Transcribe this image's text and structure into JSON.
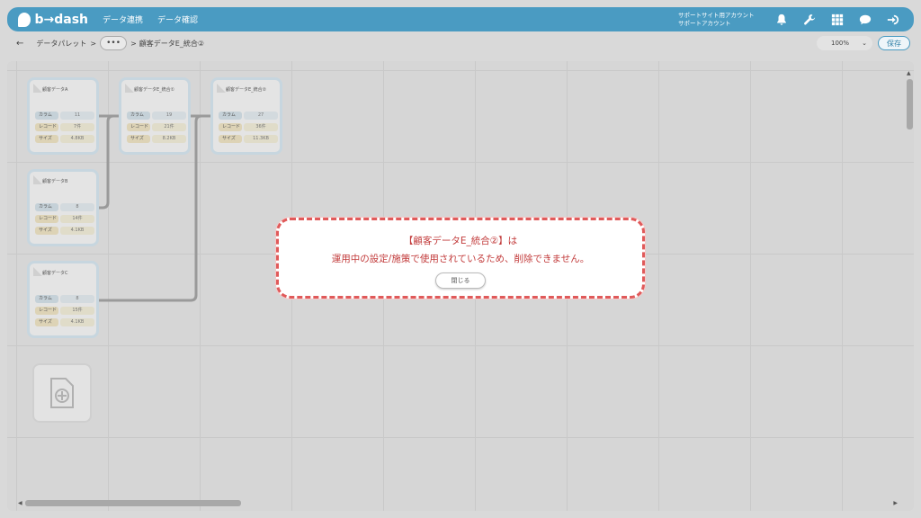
{
  "header": {
    "logo_text": "b→dash",
    "nav": [
      "データ連携",
      "データ確認"
    ],
    "account_line1": "サポートサイト用アカウント",
    "account_line2": "サポートアカウント"
  },
  "breadcrumb": {
    "root": "データパレット",
    "sep1": ">",
    "more": "•••",
    "sep2": ">",
    "current": "顧客データE_統合②"
  },
  "toolbar": {
    "zoom": "100%",
    "save_label": "保存"
  },
  "cards": [
    {
      "title": "顧客データA",
      "column_label": "カラム",
      "column_value": "11",
      "record_label": "レコード",
      "record_value": "7件",
      "size_label": "サイズ",
      "size_value": "4.8KB"
    },
    {
      "title": "顧客データE_統合①",
      "column_label": "カラム",
      "column_value": "19",
      "record_label": "レコード",
      "record_value": "21件",
      "size_label": "サイズ",
      "size_value": "8.2KB"
    },
    {
      "title": "顧客データE_統合②",
      "column_label": "カラム",
      "column_value": "27",
      "record_label": "レコード",
      "record_value": "36件",
      "size_label": "サイズ",
      "size_value": "11.3KB"
    },
    {
      "title": "顧客データB",
      "column_label": "カラム",
      "column_value": "8",
      "record_label": "レコード",
      "record_value": "14件",
      "size_label": "サイズ",
      "size_value": "4.1KB"
    },
    {
      "title": "顧客データC",
      "column_label": "カラム",
      "column_value": "8",
      "record_label": "レコード",
      "record_value": "15件",
      "size_label": "サイズ",
      "size_value": "4.1KB"
    }
  ],
  "modal": {
    "title": "【顧客データE_統合②】は",
    "message": "運用中の設定/施策で使用されているため、削除できません。",
    "close_label": "閉じる"
  },
  "colors": {
    "brand": "#4a9bc2",
    "alert": "#e05a5a"
  }
}
